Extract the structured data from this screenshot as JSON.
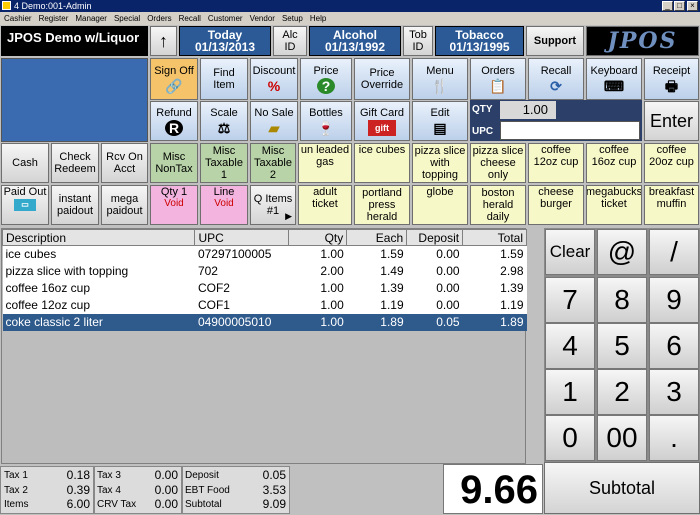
{
  "window": {
    "title": "4 Demo:001-Admin",
    "min": "_",
    "max": "□",
    "close": "×"
  },
  "menu": [
    "Cashier",
    "Register",
    "Manager",
    "Special",
    "Orders",
    "Recall",
    "Customer",
    "Vendor",
    "Setup",
    "Help"
  ],
  "header": {
    "brand": "JPOS Demo w/Liquor",
    "up": "↑",
    "today_label": "Today",
    "today_date": "01/13/2013",
    "alc_label": "Alc\nID",
    "alc_title": "Alcohol",
    "alc_date": "01/13/1992",
    "tob_label": "Tob\nID",
    "tob_title": "Tobacco",
    "tob_date": "01/13/1995",
    "support": "Support",
    "logo": "JPOS"
  },
  "functions": {
    "signoff": "Sign Off",
    "finditem": "Find\nItem",
    "discount": "Discount",
    "price": "Price",
    "priceoverride": "Price\nOverride",
    "menu": "Menu",
    "orders": "Orders",
    "recall": "Recall",
    "keyboard": "Keyboard",
    "receipt": "Receipt",
    "refund": "Refund",
    "scale": "Scale",
    "nosale": "No Sale",
    "bottles": "Bottles",
    "giftcard": "Gift Card",
    "edit": "Edit",
    "qty_label": "QTY",
    "qty_value": "1.00",
    "upc_label": "UPC",
    "upc_value": "",
    "enter": "Enter"
  },
  "row3": [
    "Cash",
    "Check\nRedeem",
    "Rcv On\nAcct",
    "Misc\nNonTax",
    "Misc\nTaxable\n1",
    "Misc\nTaxable\n2",
    "un leaded\ngas",
    "ice cubes",
    "pizza slice\nwith\ntopping",
    "pizza slice\ncheese\nonly",
    "coffee\n12oz cup",
    "coffee\n16oz cup",
    "coffee\n20oz cup"
  ],
  "row4": [
    "Paid Out",
    "instant\npaidout",
    "mega\npaidout",
    "Qty 1",
    "Line",
    "Q Items\n#1",
    "adult ticket",
    "portland\npress\nherald",
    "globe",
    "boston\nherald\ndaily",
    "cheese\nburger",
    "megabucks\nticket",
    "breakfast\nmuffin"
  ],
  "void_label": "Void",
  "grid": {
    "headers": [
      "Description",
      "UPC",
      "Qty",
      "Each",
      "Deposit",
      "Total"
    ],
    "rows": [
      [
        "ice cubes",
        "07297100005",
        "1.00",
        "1.59",
        "0.00",
        "1.59"
      ],
      [
        "pizza slice with topping",
        "702",
        "2.00",
        "1.49",
        "0.00",
        "2.98"
      ],
      [
        "coffee 16oz cup",
        "COF2",
        "1.00",
        "1.39",
        "0.00",
        "1.39"
      ],
      [
        "coffee 12oz cup",
        "COF1",
        "1.00",
        "1.19",
        "0.00",
        "1.19"
      ],
      [
        "coke classic 2 liter",
        "04900005010",
        "1.00",
        "1.89",
        "0.05",
        "1.89"
      ]
    ]
  },
  "keypad": {
    "clear": "Clear",
    "at": "@",
    "slash": "/",
    "keys": [
      "7",
      "8",
      "9",
      "4",
      "5",
      "6",
      "1",
      "2",
      "3",
      "0",
      "00",
      "."
    ],
    "subtotal": "Subtotal"
  },
  "totals": {
    "tax1_label": "Tax 1",
    "tax1": "0.18",
    "tax2_label": "Tax 2",
    "tax2": "0.39",
    "items_label": "Items",
    "items": "6.00",
    "tax3_label": "Tax 3",
    "tax3": "0.00",
    "tax4_label": "Tax 4",
    "tax4": "0.00",
    "crv_label": "CRV Tax",
    "crv": "0.00",
    "deposit_label": "Deposit",
    "deposit": "0.05",
    "ebt_label": "EBT Food",
    "ebt": "3.53",
    "subtotal_label": "Subtotal",
    "subtotal": "9.09",
    "grand": "9.66"
  }
}
